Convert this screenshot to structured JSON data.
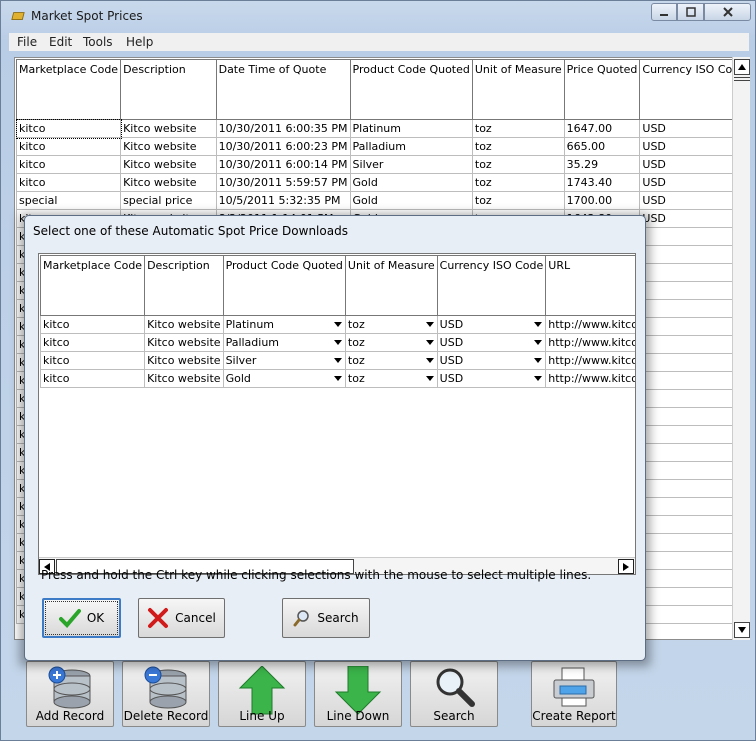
{
  "window": {
    "title": "Market Spot Prices"
  },
  "menu": [
    "File",
    "Edit",
    "Tools",
    "Help"
  ],
  "main_grid": {
    "columns": [
      "Marketplace Code",
      "Description",
      "Date Time of Quote",
      "Product Code Quoted",
      "Unit of Measure",
      "Price Quoted",
      "Currency ISO Code"
    ],
    "rows": [
      [
        "kitco",
        "Kitco website",
        "10/30/2011 6:00:35 PM",
        "Platinum",
        "toz",
        "1647.00",
        "USD"
      ],
      [
        "kitco",
        "Kitco website",
        "10/30/2011 6:00:23 PM",
        "Palladium",
        "toz",
        "665.00",
        "USD"
      ],
      [
        "kitco",
        "Kitco website",
        "10/30/2011 6:00:14 PM",
        "Silver",
        "toz",
        "35.29",
        "USD"
      ],
      [
        "kitco",
        "Kitco website",
        "10/30/2011 5:59:57 PM",
        "Gold",
        "toz",
        "1743.40",
        "USD"
      ],
      [
        "special",
        "special price",
        "10/5/2011 5:32:35 PM",
        "Gold",
        "toz",
        "1700.00",
        "USD"
      ],
      [
        "kitco",
        "Kitco website",
        "8/2/2011 1:14:01 PM",
        "Gold",
        "toz",
        "1642.80",
        "USD"
      ]
    ],
    "hidden_row_prefix": "ki"
  },
  "dialog": {
    "title": "Select one of these Automatic Spot Price Downloads",
    "columns": [
      "Marketplace Code",
      "Description",
      "Product Code Quoted",
      "Unit of Measure",
      "Currency ISO Code",
      "URL"
    ],
    "rows": [
      [
        "kitco",
        "Kitco website",
        "Platinum",
        "toz",
        "USD",
        "http://www.kitco.com/market/"
      ],
      [
        "kitco",
        "Kitco website",
        "Palladium",
        "toz",
        "USD",
        "http://www.kitco.com/market/"
      ],
      [
        "kitco",
        "Kitco website",
        "Silver",
        "toz",
        "USD",
        "http://www.kitco.com/market/"
      ],
      [
        "kitco",
        "Kitco website",
        "Gold",
        "toz",
        "USD",
        "http://www.kitco.com/market/"
      ]
    ],
    "hint": "Press and hold the Ctrl key while clicking selections with the mouse to select multiple lines.",
    "ok_label": "OK",
    "cancel_label": "Cancel",
    "search_label": "Search"
  },
  "toolbar": {
    "add_record": "Add Record",
    "delete_record": "Delete Record",
    "line_up": "Line Up",
    "line_down": "Line Down",
    "search": "Search",
    "create_report": "Create Report"
  },
  "colors": {
    "ok_check": "#2aa52a",
    "cancel_x": "#d11a1a",
    "arrow_green": "#3bb54a"
  }
}
